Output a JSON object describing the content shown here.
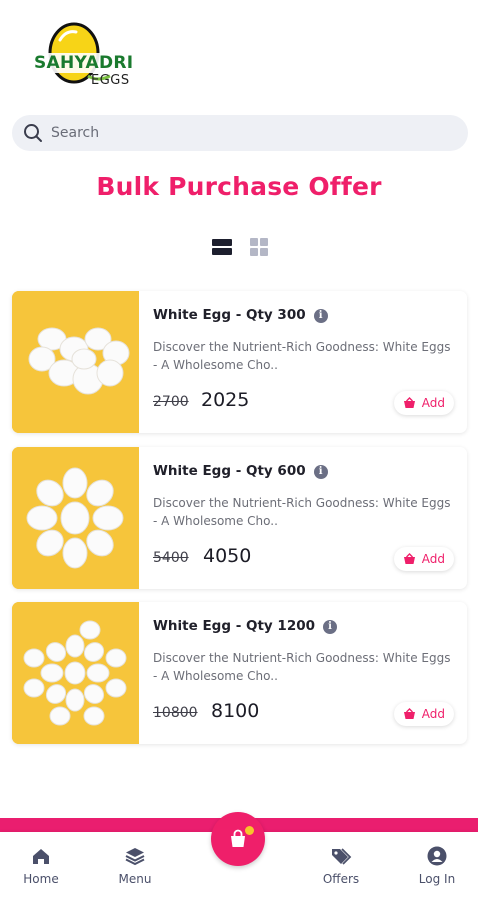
{
  "logo": {
    "line1": "SAHYADRI",
    "line2": "EGGS"
  },
  "search": {
    "placeholder": "Search"
  },
  "page_title": "Bulk Purchase Offer",
  "view_toggle": {
    "active": "list"
  },
  "products": [
    {
      "name": "White Egg - Qty 300",
      "description": "Discover the Nutrient-Rich Goodness: White Eggs - A Wholesome Cho..",
      "original_price": "2700",
      "price": "2025",
      "add_label": "Add"
    },
    {
      "name": "White Egg - Qty 600",
      "description": "Discover the Nutrient-Rich Goodness: White Eggs - A Wholesome Cho..",
      "original_price": "5400",
      "price": "4050",
      "add_label": "Add"
    },
    {
      "name": "White Egg - Qty 1200",
      "description": "Discover the Nutrient-Rich Goodness: White Eggs - A Wholesome Cho..",
      "original_price": "10800",
      "price": "8100",
      "add_label": "Add"
    }
  ],
  "bottom_nav": {
    "home": "Home",
    "menu": "Menu",
    "offers": "Offers",
    "login": "Log In"
  },
  "colors": {
    "accent": "#ef1f6a",
    "badge": "#f7c52b",
    "nav_icon": "#4b506a"
  },
  "icons": [
    "search-icon",
    "list-view-icon",
    "grid-view-icon",
    "info-icon",
    "basket-icon",
    "home-icon",
    "layers-icon",
    "tags-icon",
    "user-icon",
    "cart-icon"
  ]
}
